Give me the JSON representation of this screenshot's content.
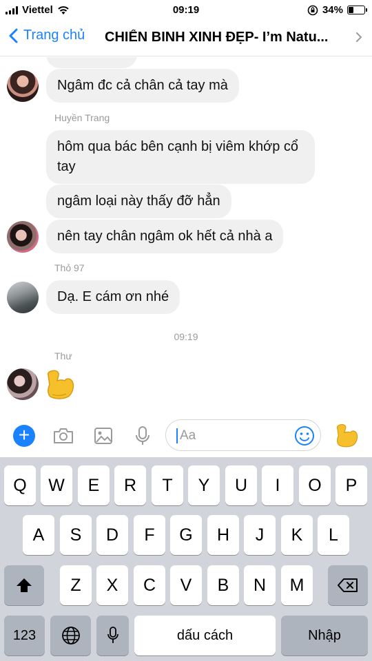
{
  "status_bar": {
    "carrier": "Viettel",
    "time": "09:19",
    "battery_percent": "34%",
    "battery_level": 0.34
  },
  "nav": {
    "back_label": "Trang chủ",
    "title": "CHIẾN BINH XINH ĐẸP- I’m Natu..."
  },
  "messages": {
    "m1": "Ngâm đc cả chân cả tay mà",
    "sender_huyen": "Huyền Trang",
    "m2": "hôm qua bác bên cạnh bị viêm khớp cổ tay",
    "m3": "ngâm loại này thấy đỡ hẳn",
    "m4": "nên tay chân ngâm ok hết cả nhà a",
    "sender_tho": "Thỏ 97",
    "m5": "Dạ. E cám ơn nhé",
    "timestamp": "09:19",
    "sender_thu": "Thư",
    "m6_emoji": "flexed-biceps"
  },
  "composer": {
    "placeholder": "Aa"
  },
  "keyboard": {
    "row1": [
      "Q",
      "W",
      "E",
      "R",
      "T",
      "Y",
      "U",
      "I",
      "O",
      "P"
    ],
    "row2": [
      "A",
      "S",
      "D",
      "F",
      "G",
      "H",
      "J",
      "K",
      "L"
    ],
    "row3": [
      "Z",
      "X",
      "C",
      "V",
      "B",
      "N",
      "M"
    ],
    "numbers_label": "123",
    "space_label": "dấu cách",
    "return_label": "Nhập"
  },
  "colors": {
    "accent": "#1a82ff",
    "bubble": "#f1f0f0",
    "keyboard_bg": "#d1d5db",
    "emoji": "#f6c02c"
  }
}
